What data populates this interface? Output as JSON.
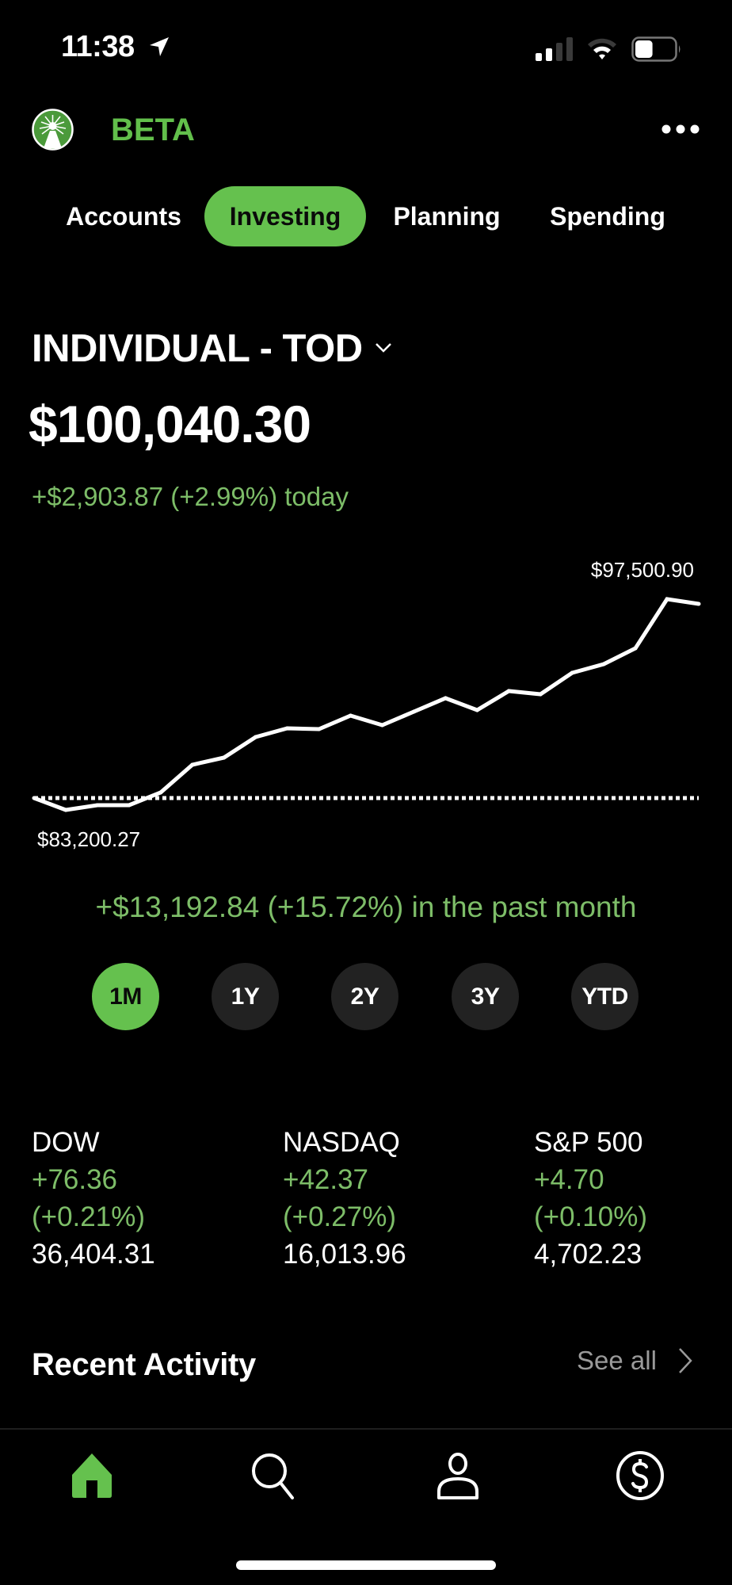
{
  "status_bar": {
    "time": "11:38",
    "location_icon": "location-arrow-icon",
    "signal_icon": "cellular-signal-icon",
    "signal_bars_lit": 2,
    "signal_bars_total": 4,
    "wifi_icon": "wifi-icon",
    "battery_icon": "battery-icon",
    "battery_level": 0.45
  },
  "header": {
    "logo_icon": "fidelity-logo-icon",
    "title": "BETA",
    "more_icon": "more-horizontal-icon"
  },
  "tabs": [
    {
      "label": "Accounts",
      "active": false
    },
    {
      "label": "Investing",
      "active": true
    },
    {
      "label": "Planning",
      "active": false
    },
    {
      "label": "Spending",
      "active": false
    }
  ],
  "account": {
    "name": "INDIVIDUAL - TOD",
    "dropdown_icon": "chevron-down-icon",
    "balance": "$100,040.30",
    "today_change": "+$2,903.87 (+2.99%) today"
  },
  "chart_data": {
    "type": "line",
    "title": "",
    "xlabel": "",
    "ylabel": "",
    "period": "1M",
    "x": [
      1,
      2,
      3,
      4,
      5,
      6,
      7,
      8,
      9,
      10,
      11,
      12,
      13,
      14,
      15,
      16,
      17,
      18,
      19,
      20,
      21,
      22
    ],
    "series": [
      {
        "name": "Account value",
        "values": [
          84006,
          83200.27,
          83523,
          83523,
          84383,
          86265,
          86749,
          88146,
          88738,
          88684,
          89598,
          88953,
          89867,
          90781,
          89974,
          91264,
          91049,
          92501,
          93092,
          94167,
          97500.9,
          97178
        ]
      }
    ],
    "baseline": 84006,
    "baseline_style": "dotted",
    "annotations": {
      "high_label": "$97,500.90",
      "low_label": "$83,200.27"
    },
    "ylim": [
      83200.27,
      97500.9
    ],
    "grid": false,
    "legend": "none"
  },
  "period_change": "+$13,192.84 (+15.72%) in the past month",
  "ranges": [
    {
      "label": "1M",
      "active": true
    },
    {
      "label": "1Y",
      "active": false
    },
    {
      "label": "2Y",
      "active": false
    },
    {
      "label": "3Y",
      "active": false
    },
    {
      "label": "YTD",
      "active": false
    }
  ],
  "indices": [
    {
      "name": "DOW",
      "change": "+76.36",
      "percent": "(+0.21%)",
      "value": "36,404.31"
    },
    {
      "name": "NASDAQ",
      "change": "+42.37",
      "percent": "(+0.27%)",
      "value": "16,013.96"
    },
    {
      "name": "S&P 500",
      "change": "+4.70",
      "percent": "(+0.10%)",
      "value": "4,702.23"
    }
  ],
  "recent_activity": {
    "title": "Recent Activity",
    "see_all": "See all",
    "chevron_icon": "chevron-right-icon"
  },
  "bottom_nav": [
    {
      "icon": "home-icon",
      "active": true
    },
    {
      "icon": "search-icon",
      "active": false
    },
    {
      "icon": "profile-icon",
      "active": false
    },
    {
      "icon": "dollar-circle-icon",
      "active": false
    }
  ],
  "colors": {
    "accent": "#65c14e",
    "positive": "#7dbd68",
    "background": "#000000",
    "inactive_pill": "#222222",
    "muted_text": "#9a9a9a"
  }
}
